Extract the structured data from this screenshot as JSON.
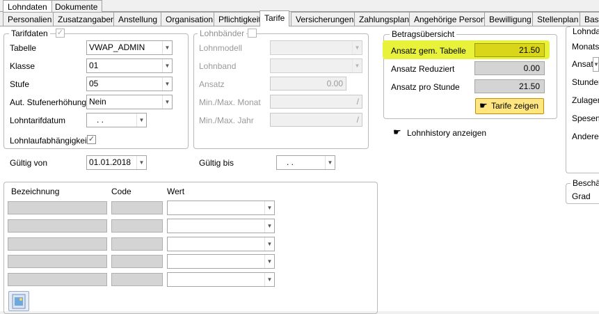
{
  "top_tabs": [
    "Lohndaten",
    "Dokumente"
  ],
  "sub_tabs": [
    "Personalien",
    "Zusatzangaben",
    "Anstellung",
    "Organisation",
    "Pflichtigkeit",
    "Tarife",
    "Versicherungen",
    "Zahlungsplan",
    "Angehörige Person",
    "Bewilligung",
    "Stellenplan",
    "Basis"
  ],
  "tarifdaten": {
    "title": "Tarifdaten",
    "tabelle_label": "Tabelle",
    "tabelle_value": "VWAP_ADMIN",
    "klasse_label": "Klasse",
    "klasse_value": "01",
    "stufe_label": "Stufe",
    "stufe_value": "05",
    "aut_label": "Aut. Stufenerhöhung",
    "aut_value": "Nein",
    "lohntarifdatum_label": "Lohntarifdatum",
    "lohntarifdatum_value": ". .",
    "lohnlauf_label": "Lohnlaufabhängigkeit",
    "checkmark": "✓"
  },
  "lohnbaender": {
    "title": "Lohnbänder",
    "lohnmodell_label": "Lohnmodell",
    "lohnband_label": "Lohnband",
    "ansatz_label": "Ansatz",
    "ansatz_value": "0.00",
    "monat_label": "Min./Max. Monat",
    "monat_value": "/",
    "jahr_label": "Min./Max. Jahr",
    "jahr_value": "/"
  },
  "betrag": {
    "title": "Betragsübersicht",
    "row1_label": "Ansatz gem. Tabelle",
    "row1_value": "21.50",
    "row2_label": "Ansatz Reduziert",
    "row2_value": "0.00",
    "row3_label": "Ansatz pro Stunde",
    "row3_value": "21.50",
    "button": "Tarife zeigen",
    "highlight_color": "#e8f23a"
  },
  "lohnhistory": "Lohnhistory anzeigen",
  "gueltig_von_label": "Gültig von",
  "gueltig_von_value": "01.01.2018",
  "gueltig_bis_label": "Gültig bis",
  "gueltig_bis_value": ". .",
  "grid": {
    "col1": "Bezeichnung",
    "col2": "Code",
    "col3": "Wert"
  },
  "right_panel": {
    "title": "Lohndat",
    "rows": [
      "Monatslo",
      "Ansatz F",
      "Stunden",
      "Zulagen",
      "Spesen",
      "Andere"
    ],
    "besch_title": "Beschä",
    "grad": "Grad"
  }
}
